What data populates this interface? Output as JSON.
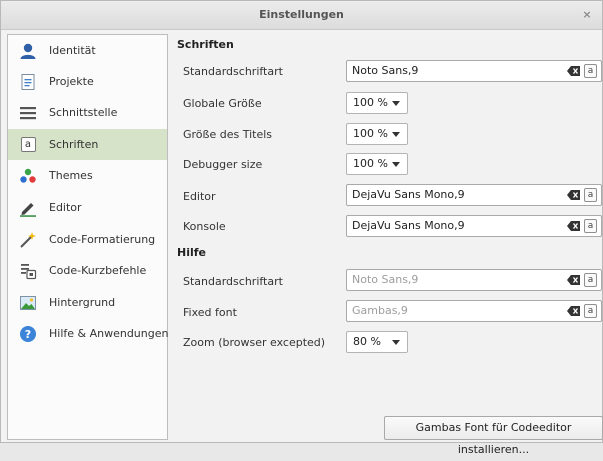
{
  "window": {
    "title": "Einstellungen",
    "close_glyph": "×"
  },
  "sidebar": {
    "items": [
      {
        "label": "Identität",
        "icon": "user-icon"
      },
      {
        "label": "Projekte",
        "icon": "document-icon"
      },
      {
        "label": "Schnittstelle",
        "icon": "interface-icon"
      },
      {
        "label": "Schriften",
        "icon": "font-icon",
        "active": true
      },
      {
        "label": "Themes",
        "icon": "themes-icon"
      },
      {
        "label": "Editor",
        "icon": "pencil-icon"
      },
      {
        "label": "Code-Formatierung",
        "icon": "magic-wand-icon"
      },
      {
        "label": "Code-Kurzbefehle",
        "icon": "shortcuts-icon"
      },
      {
        "label": "Hintergrund",
        "icon": "image-icon"
      },
      {
        "label": "Hilfe & Anwendungen",
        "icon": "help-icon"
      }
    ],
    "font_icon_glyph": "a"
  },
  "fonts": {
    "heading": "Schriften",
    "default_label": "Standardschriftart",
    "default_value": "Noto Sans,9",
    "global_size_label": "Globale Größe",
    "global_size_value": "100 %",
    "title_size_label": "Größe des Titels",
    "title_size_value": "100 %",
    "debugger_size_label": "Debugger size",
    "debugger_size_value": "100 %",
    "editor_label": "Editor",
    "editor_value": "DejaVu Sans Mono,9",
    "console_label": "Konsole",
    "console_value": "DejaVu Sans Mono,9"
  },
  "help": {
    "heading": "Hilfe",
    "default_label": "Standardschriftart",
    "default_value": "Noto Sans,9",
    "fixed_label": "Fixed font",
    "fixed_value": "Gambas,9",
    "zoom_label": "Zoom (browser excepted)",
    "zoom_value": "80 %"
  },
  "field_button_glyph": "a",
  "install_button": "Gambas Font für Codeeditor installieren..."
}
